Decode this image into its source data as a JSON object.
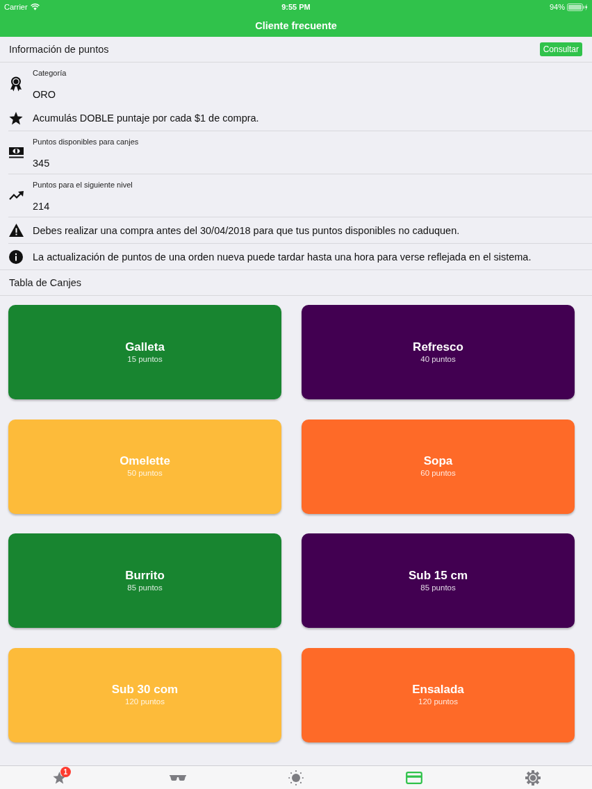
{
  "status_bar": {
    "carrier": "Carrier",
    "time": "9:55 PM",
    "battery": "94%"
  },
  "nav_bar": {
    "title": "Cliente frecuente"
  },
  "points_info": {
    "title": "Información de puntos",
    "button": "Consultar",
    "items": [
      {
        "kind": "category",
        "label": "Categoría",
        "value": "ORO",
        "benefit": "Acumulás DOBLE puntaje por cada $1 de compra."
      },
      {
        "kind": "field",
        "label": "Puntos disponibles para canjes",
        "value": "345"
      },
      {
        "kind": "field",
        "label": "Puntos para el siguiente nivel",
        "value": "214"
      },
      {
        "kind": "warning",
        "text": "Debes realizar una compra antes del 30/04/2018 para que tus puntos disponibles no caduquen."
      },
      {
        "kind": "info",
        "text": "La actualización de puntos de una orden nueva puede tardar hasta una hora para verse reflejada en el sistema."
      }
    ]
  },
  "rewards": {
    "title": "Tabla de Canjes",
    "cards": [
      {
        "name": "Galleta",
        "points": "15 puntos",
        "color": "#188530"
      },
      {
        "name": "Refresco",
        "points": "40 puntos",
        "color": "#420051"
      },
      {
        "name": "Omelette",
        "points": "50 puntos",
        "color": "#fdbb3a"
      },
      {
        "name": "Sopa",
        "points": "60 puntos",
        "color": "#fe6a28"
      },
      {
        "name": "Burrito",
        "points": "85 puntos",
        "color": "#188530"
      },
      {
        "name": "Sub 15 cm",
        "points": "85 puntos",
        "color": "#420051"
      },
      {
        "name": "Sub 30 com",
        "points": "120 puntos",
        "color": "#fdbb3a"
      },
      {
        "name": "Ensalada",
        "points": "120 puntos",
        "color": "#fe6a28"
      }
    ]
  },
  "tab_bar": {
    "tabs": [
      {
        "selected": false,
        "badge": "1"
      },
      {
        "selected": false
      },
      {
        "selected": false
      },
      {
        "selected": true
      },
      {
        "selected": false
      }
    ]
  }
}
